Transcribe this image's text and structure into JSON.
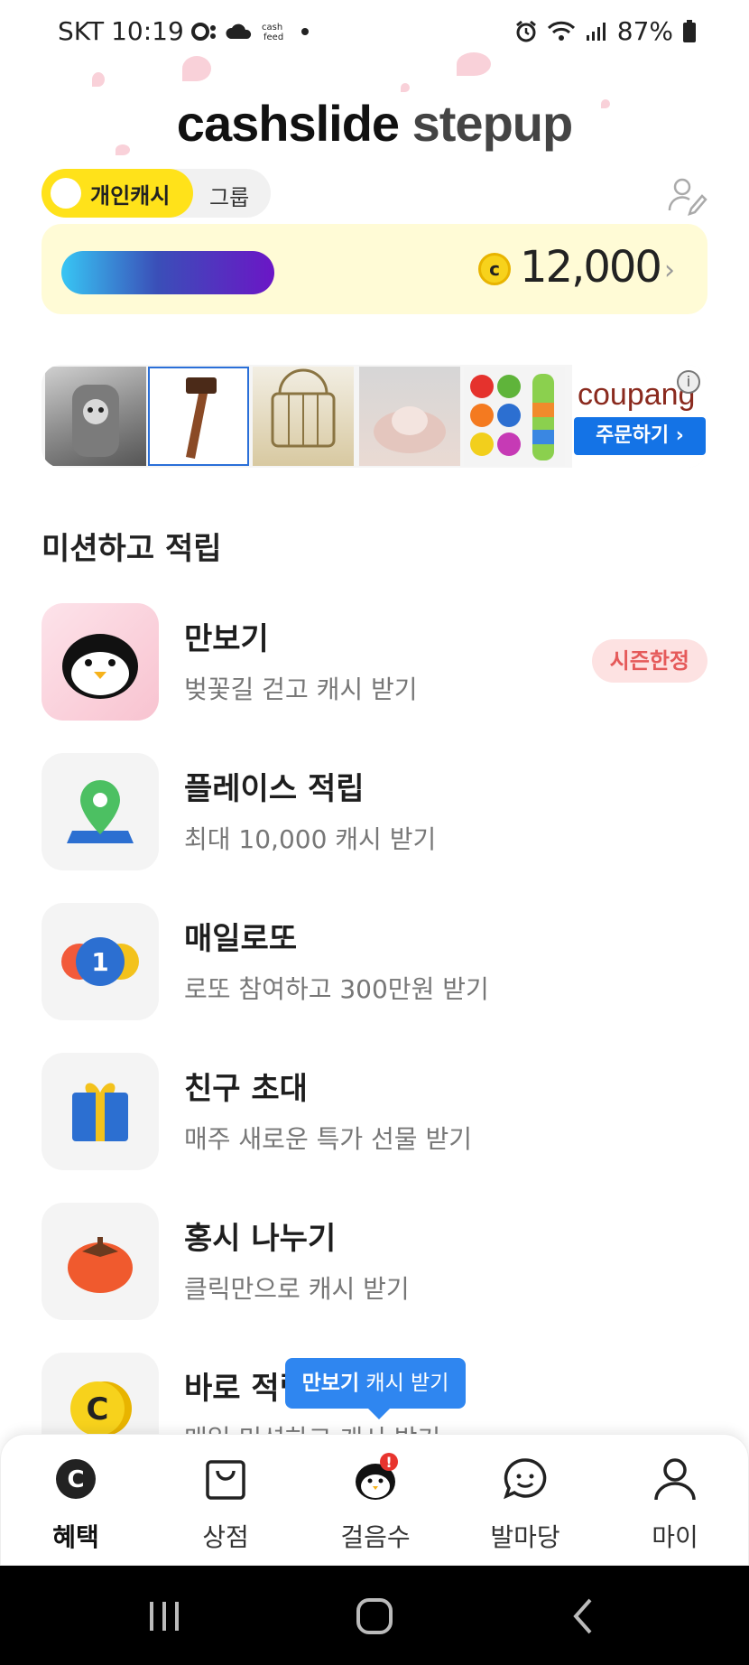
{
  "status_bar": {
    "carrier": "SKT",
    "time": "10:19",
    "battery": "87%",
    "icons": [
      "bubble-icon",
      "cloud-icon",
      "cashfeed-icon",
      "dot-icon",
      "alarm-icon",
      "wifi-icon",
      "signal-icon",
      "battery-icon"
    ]
  },
  "header": {
    "logo_part1": "cashslide",
    "logo_part2": "stepup"
  },
  "mode_toggle": {
    "selected": "개인캐시",
    "other": "그룹"
  },
  "balance": {
    "coin_symbol": "c",
    "amount": "12,000",
    "progress_fraction": 0.35
  },
  "ad": {
    "brand": "coupang",
    "order_label": "주문하기 ›"
  },
  "missions_section": {
    "title": "미션하고 적립",
    "items": [
      {
        "title": "만보기",
        "desc": "벚꽃길 걷고 캐시 받기",
        "badge": "시즌한정",
        "icon": "penguin-icon"
      },
      {
        "title": "플레이스 적립",
        "desc": "최대 10,000 캐시 받기",
        "icon": "location-pin-icon"
      },
      {
        "title": "매일로또",
        "desc": "로또 참여하고 300만원 받기",
        "icon": "lotto-ball-icon"
      },
      {
        "title": "친구 초대",
        "desc": "매주 새로운 특가 선물 받기",
        "icon": "gift-icon"
      },
      {
        "title": "홍시 나누기",
        "desc": "클릭만으로 캐시 받기",
        "icon": "persimmon-icon"
      },
      {
        "title": "바로 적립",
        "desc": "매일 미션하고 캐시 받기",
        "icon": "coin-icon"
      }
    ]
  },
  "tooltip": {
    "bold": "만보기",
    "rest": " 캐시 받기"
  },
  "bottom_nav": {
    "items": [
      {
        "label": "혜택",
        "icon": "benefit-coin-icon",
        "active": true
      },
      {
        "label": "상점",
        "icon": "shopping-bag-icon"
      },
      {
        "label": "걸음수",
        "icon": "penguin-steps-icon",
        "alert": "!"
      },
      {
        "label": "발마당",
        "icon": "chat-smile-icon"
      },
      {
        "label": "마이",
        "icon": "person-icon"
      }
    ]
  },
  "colors": {
    "accent_yellow": "#ffe21a",
    "balance_bg": "#fffbd6",
    "tooltip_blue": "#2f86f0",
    "badge_red": "#e55a5a"
  }
}
